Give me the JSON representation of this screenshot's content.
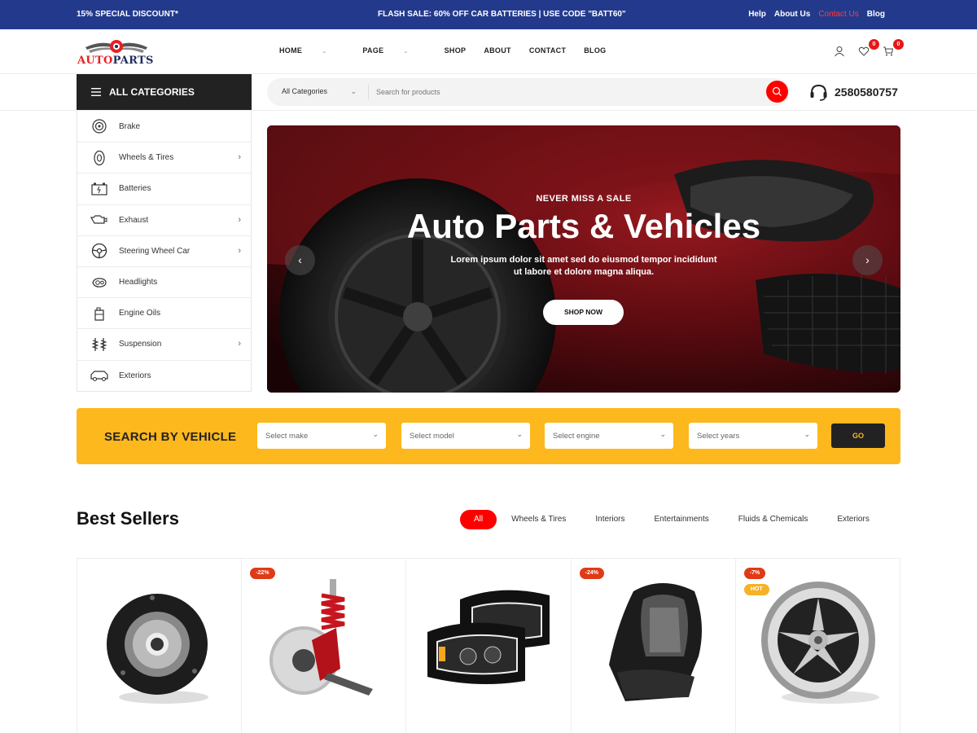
{
  "topbar": {
    "promo": "15% SPECIAL DISCOUNT*",
    "flash": "FLASH SALE: 60% OFF CAR BATTERIES | USE CODE \"BATT60\"",
    "links": [
      "Help",
      "About Us",
      "Contact Us",
      "Blog"
    ]
  },
  "logo": {
    "part1": "AUTO",
    "part2": "PARTS"
  },
  "nav": {
    "items": [
      "HOME",
      "PAGE",
      "SHOP",
      "ABOUT",
      "CONTACT",
      "BLOG"
    ]
  },
  "header_icons": {
    "wishlist_count": "0",
    "cart_count": "0",
    "icons": [
      "user-icon",
      "heart-icon",
      "cart-icon"
    ]
  },
  "categories": {
    "title": "ALL CATEGORIES",
    "items": [
      {
        "label": "Brake",
        "icon": "brake-icon",
        "has_sub": false
      },
      {
        "label": "Wheels & Tires",
        "icon": "tire-icon",
        "has_sub": true
      },
      {
        "label": "Batteries",
        "icon": "battery-icon",
        "has_sub": false
      },
      {
        "label": "Exhaust",
        "icon": "exhaust-icon",
        "has_sub": true
      },
      {
        "label": "Steering Wheel Car",
        "icon": "steering-wheel-icon",
        "has_sub": true
      },
      {
        "label": "Headlights",
        "icon": "headlight-icon",
        "has_sub": false
      },
      {
        "label": "Engine Oils",
        "icon": "oil-icon",
        "has_sub": false
      },
      {
        "label": "Suspension",
        "icon": "suspension-icon",
        "has_sub": true
      },
      {
        "label": "Exteriors",
        "icon": "car-exterior-icon",
        "has_sub": false
      }
    ]
  },
  "search": {
    "category": "All Categories",
    "placeholder": "Search for products"
  },
  "phone": "2580580757",
  "hero": {
    "subtitle": "NEVER MISS A SALE",
    "title": "Auto Parts & Vehicles",
    "description": "Lorem ipsum dolor sit amet sed do eiusmod tempor incididunt ut labore et dolore magna aliqua.",
    "button": "SHOP NOW"
  },
  "vehicle_search": {
    "title": "SEARCH BY VEHICLE",
    "selects": [
      "Select make",
      "Select model",
      "Select engine",
      "Select years"
    ],
    "button": "GO"
  },
  "best_sellers": {
    "title": "Best Sellers",
    "tabs": [
      "All",
      "Wheels & Tires",
      "Interiors",
      "Entertainments",
      "Fluids & Chemicals",
      "Exteriors"
    ],
    "active_tab": "All",
    "products": [
      {
        "badge": "",
        "hot": ""
      },
      {
        "badge": "-22%",
        "hot": ""
      },
      {
        "badge": "",
        "hot": ""
      },
      {
        "badge": "-24%",
        "hot": ""
      },
      {
        "badge": "-7%",
        "hot": "HOT"
      }
    ]
  },
  "colors": {
    "topbar": "#233a8c",
    "accent": "#ff0000",
    "vehicle_bg": "#fdb81e",
    "dark": "#222222"
  }
}
